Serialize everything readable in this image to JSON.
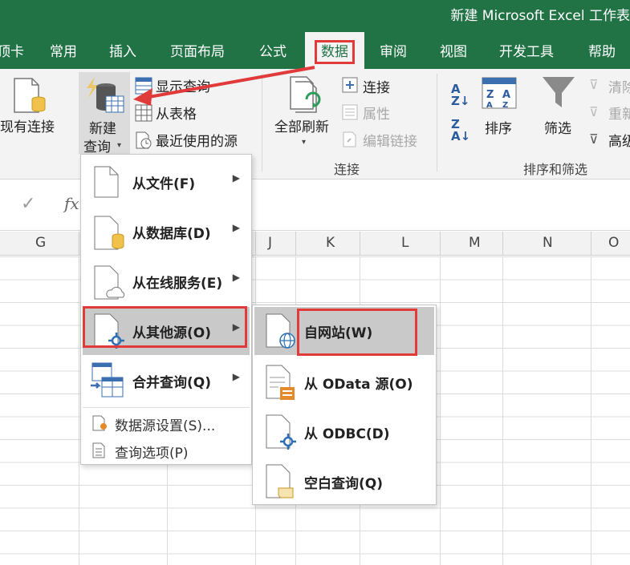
{
  "window": {
    "title": "新建 Microsoft Excel 工作表"
  },
  "tabs": [
    {
      "label": "顶卡"
    },
    {
      "label": "常用"
    },
    {
      "label": "插入"
    },
    {
      "label": "页面布局"
    },
    {
      "label": "公式"
    },
    {
      "label": "数据"
    },
    {
      "label": "审阅"
    },
    {
      "label": "视图"
    },
    {
      "label": "开发工具"
    },
    {
      "label": "帮助"
    }
  ],
  "active_tab": "数据",
  "ribbon": {
    "existing_connections": "现有连接",
    "new_query_line1": "新建",
    "new_query_line2": "查询",
    "show_queries": "显示查询",
    "from_table": "从表格",
    "recent_sources": "最近使用的源",
    "refresh_all": "全部刷新",
    "connections": "连接",
    "properties": "属性",
    "edit_links": "编辑链接",
    "connections_group": "连接",
    "sort": "排序",
    "filter": "筛选",
    "clear": "清除",
    "reapply": "重新",
    "advanced": "高级",
    "sort_filter_group": "排序和筛选"
  },
  "formula_bar": {
    "check": "✓",
    "fx": "fx"
  },
  "columns": [
    "G",
    "J",
    "K",
    "L",
    "M",
    "N",
    "O"
  ],
  "menu_main": {
    "items": [
      {
        "label": "从文件(F)",
        "icon": "file-icon"
      },
      {
        "label": "从数据库(D)",
        "icon": "database-icon"
      },
      {
        "label": "从在线服务(E)",
        "icon": "cloud-icon"
      },
      {
        "label": "从其他源(O)",
        "icon": "other-source-icon"
      },
      {
        "label": "合并查询(Q)",
        "icon": "combine-icon"
      }
    ],
    "data_source_settings": "数据源设置(S)...",
    "query_options": "查询选项(P)"
  },
  "menu_sub": {
    "items": [
      {
        "label": "自网站(W)",
        "icon": "web-icon"
      },
      {
        "label": "从 OData 源(O)",
        "icon": "odata-icon"
      },
      {
        "label": "从 ODBC(D)",
        "icon": "odbc-icon"
      },
      {
        "label": "空白查询(Q)",
        "icon": "blank-query-icon"
      }
    ]
  },
  "colors": {
    "excel_green": "#217346",
    "highlight_red": "#e03a3a"
  }
}
